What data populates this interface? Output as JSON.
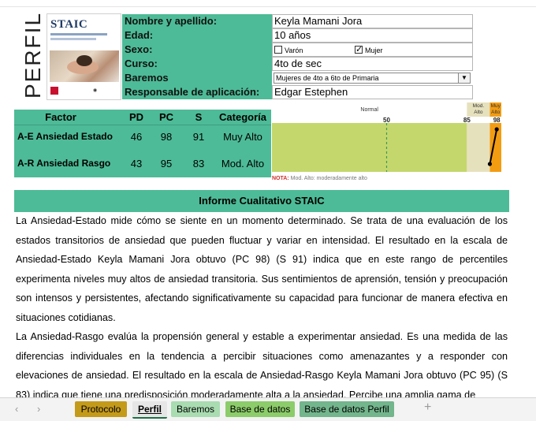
{
  "perfil_label": "PERFIL",
  "cover": {
    "title": "STAIC"
  },
  "info": {
    "rows": [
      {
        "label": "Nombre y apellido:",
        "value": "Keyla Mamani Jora"
      },
      {
        "label": "Edad:",
        "value": "10 años"
      },
      {
        "label": "Sexo:",
        "opt_male": "Varón",
        "opt_female": "Mujer",
        "selected": "Mujer"
      },
      {
        "label": "Curso:",
        "value": "4to de sec"
      },
      {
        "label": "Baremos",
        "value": "Mujeres de 4to a 6to de Primaria"
      },
      {
        "label": "Responsable de aplicación:",
        "value": "Edgar Estephen"
      }
    ]
  },
  "factor_table": {
    "headers": [
      "Factor",
      "PD",
      "PC",
      "S",
      "Categoría"
    ],
    "rows": [
      {
        "factor": "A-E Ansiedad Estado",
        "pd": "46",
        "pc": "98",
        "s": "91",
        "cat": "Muy Alto"
      },
      {
        "factor": "A-R Ansiedad Rasgo",
        "pd": "43",
        "pc": "95",
        "s": "83",
        "cat": "Mod. Alto"
      }
    ]
  },
  "chart_data": {
    "type": "line",
    "zones": [
      {
        "label": "Normal",
        "from": 0,
        "to": 85,
        "color": "#c4d76d"
      },
      {
        "label": "Mod. Alto",
        "from": 85,
        "to": 95,
        "color": "#e6e1bd"
      },
      {
        "label": "Muy Alto",
        "from": 95,
        "to": 100,
        "color": "#f39c12"
      }
    ],
    "ticks": [
      50,
      85,
      98
    ],
    "reference_line": 50,
    "points": [
      {
        "name": "A-E Ansiedad Estado",
        "value": 98
      },
      {
        "name": "A-R Ansiedad Rasgo",
        "value": 95
      }
    ],
    "xlim": [
      0,
      100
    ],
    "line_color": "#000000"
  },
  "note": {
    "label": "NOTA:",
    "text": "Mod. Alto: moderadamente alto"
  },
  "report": {
    "title": "Informe Cualitativo STAIC",
    "p1": "La Ansiedad-Estado mide cómo se siente en un momento determinado. Se trata de una evaluación de los estados transitorios de ansiedad que pueden fluctuar y variar en intensidad. El resultado en la escala de Ansiedad-Estado Keyla Mamani Jora obtuvo (PC 98) (S 91) indica que en este rango de percentiles experimenta niveles muy altos de ansiedad transitoria. Sus sentimientos de aprensión, tensión y preocupación son intensos y persistentes, afectando significativamente su capacidad para funcionar de manera efectiva en situaciones cotidianas.",
    "p2": "La Ansiedad-Rasgo evalúa la propensión general y estable a experimentar ansiedad. Es una medida de las diferencias individuales en la tendencia a percibir situaciones como amenazantes y a responder con elevaciones de ansiedad. El resultado en la escala de Ansiedad-Rasgo Keyla Mamani Jora obtuvo (PC 95) (S 83) indica que tiene una predisposición moderadamente alta a la ansiedad. Percibe una amplia gama de"
  },
  "tabs": [
    {
      "label": "Protocolo",
      "color": "#c49a1a"
    },
    {
      "label": "Perfil",
      "color": "#e6e6e6",
      "active": true
    },
    {
      "label": "Baremos",
      "color": "#a9dcb1"
    },
    {
      "label": "Base de datos",
      "color": "#8ccc6a"
    },
    {
      "label": "Base de datos Perfil",
      "color": "#73b58c"
    }
  ],
  "nav": {
    "prev": "‹",
    "next": "›",
    "add": "+"
  }
}
